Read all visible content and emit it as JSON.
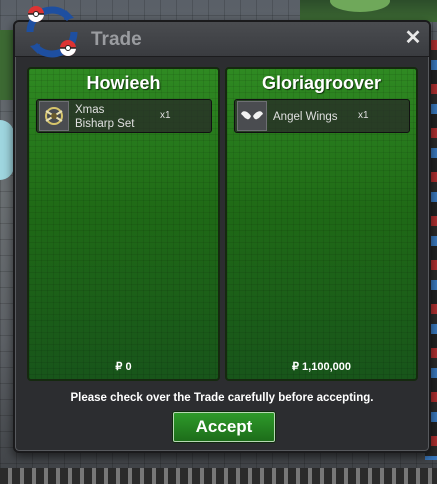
{
  "window": {
    "title": "Trade",
    "close_label": "✕"
  },
  "left_panel": {
    "player_name": "Howieeh",
    "items": [
      {
        "name_line1": "Xmas",
        "name_line2": "Bisharp Set",
        "quantity": "x1",
        "icon": "xmas-bisharp-set-icon"
      }
    ],
    "money": "₽ 0"
  },
  "right_panel": {
    "player_name": "Gloriagroover",
    "items": [
      {
        "name_line1": "Angel Wings",
        "quantity": "x1",
        "icon": "angel-wings-icon"
      }
    ],
    "money": "₽ 1,100,000"
  },
  "notice": "Please check over the Trade carefully before accepting.",
  "accept_label": "Accept",
  "colors": {
    "panel_green": "#1f6a16",
    "button_green": "#2e9a2a",
    "titlebar": "#3a3c40"
  }
}
